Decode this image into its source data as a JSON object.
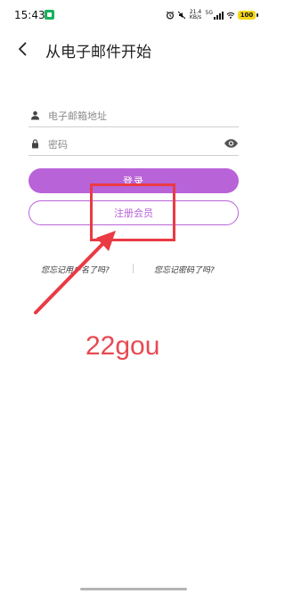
{
  "status": {
    "time": "15:43",
    "net_speed_top": "21.4",
    "net_speed_bottom": "KB/s",
    "signal_type": "5G",
    "battery": "100"
  },
  "header": {
    "title": "从电子邮件开始"
  },
  "form": {
    "email_placeholder": "电子邮箱地址",
    "password_placeholder": "密码"
  },
  "buttons": {
    "login": "登录",
    "register": "注册会员"
  },
  "links": {
    "forgot_username": "您忘记用户名了吗?",
    "forgot_password": "您忘记密码了吗?"
  },
  "watermark": "22gou",
  "colors": {
    "accent": "#b963d8",
    "annotation": "#ea3a44"
  },
  "icons": {
    "back": "chevron-left",
    "email": "person",
    "password": "lock",
    "visibility": "eye"
  }
}
